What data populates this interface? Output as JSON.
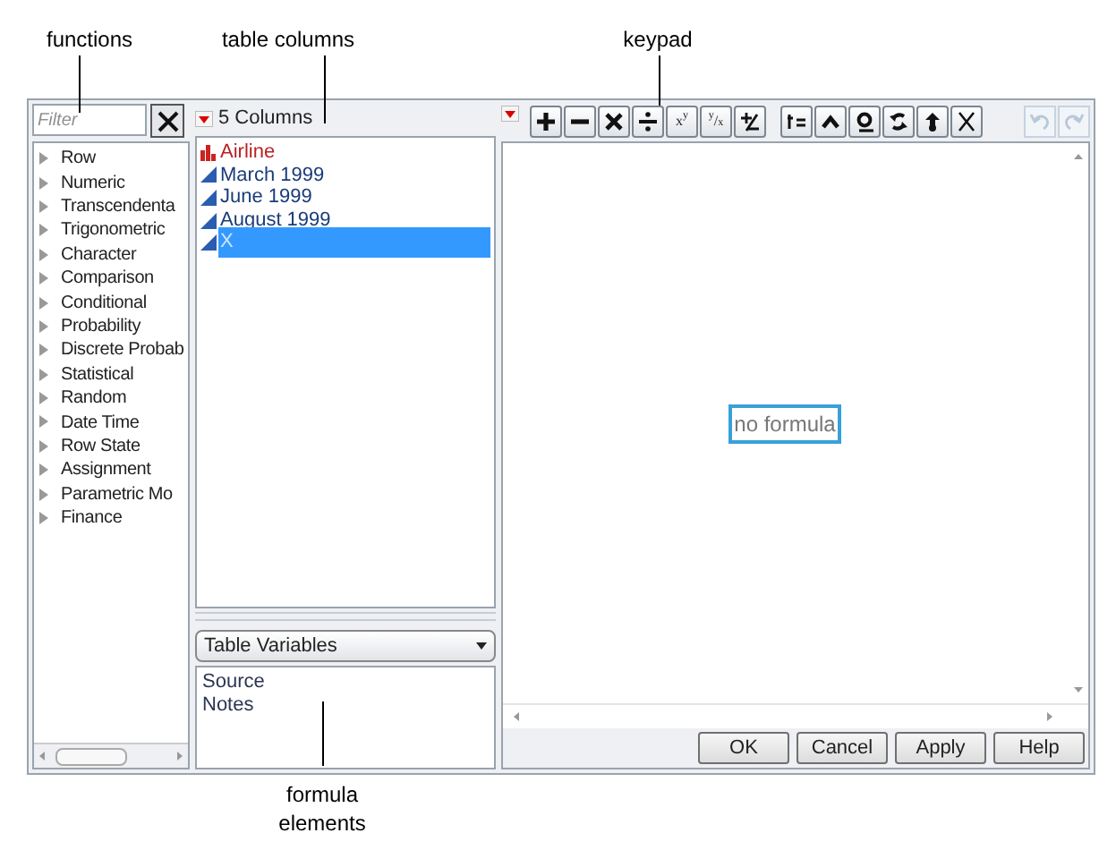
{
  "callouts": [
    {
      "text": "functions"
    },
    {
      "text": "table columns"
    },
    {
      "text": "keypad"
    },
    {
      "text": "formula elements"
    }
  ],
  "filter": {
    "placeholder": "Filter"
  },
  "functions": [
    {
      "label": "Row",
      "expanded": false
    },
    {
      "label": "Numeric",
      "expanded": false
    },
    {
      "label": "Transcendenta",
      "expanded": false
    },
    {
      "label": "Trigonometric",
      "expanded": false
    },
    {
      "label": "Character",
      "expanded": false
    },
    {
      "label": "Comparison",
      "expanded": false
    },
    {
      "label": "Conditional",
      "expanded": false
    },
    {
      "label": "Probability",
      "expanded": false
    },
    {
      "label": "Discrete Probab",
      "expanded": false
    },
    {
      "label": "Statistical",
      "expanded": false
    },
    {
      "label": "Random",
      "expanded": false
    },
    {
      "label": "Date Time",
      "expanded": false
    },
    {
      "label": "Row State",
      "expanded": false
    },
    {
      "label": "Assignment",
      "expanded": false
    },
    {
      "label": "Parametric Mo",
      "expanded": false
    },
    {
      "label": "Finance",
      "expanded": false
    }
  ],
  "columns_header": "5 Columns",
  "columns": [
    {
      "name": "Airline",
      "kind": "character",
      "selected": false
    },
    {
      "name": "March 1999",
      "kind": "numeric",
      "selected": false
    },
    {
      "name": "June 1999",
      "kind": "numeric",
      "selected": false
    },
    {
      "name": "August 1999",
      "kind": "numeric",
      "selected": false
    },
    {
      "name": "X",
      "kind": "numeric",
      "selected": true
    }
  ],
  "variables_dropdown": "Table Variables",
  "variables": [
    "Source",
    "Notes"
  ],
  "keypad": [
    [
      {
        "kind": "plus"
      },
      {
        "kind": "minus"
      },
      {
        "kind": "times"
      },
      {
        "kind": "divide"
      },
      {
        "kind": "text",
        "label": "x$^{y}$"
      },
      {
        "kind": "text",
        "label": "$^{y}$/$_{x}$"
      },
      {
        "kind": "plusminus"
      }
    ],
    [
      {
        "kind": "local"
      },
      {
        "kind": "caret"
      },
      {
        "kind": "peel"
      },
      {
        "kind": "swap"
      },
      {
        "kind": "unary"
      },
      {
        "kind": "delete"
      }
    ]
  ],
  "undo": {
    "disabled": true
  },
  "redo": {
    "disabled": true
  },
  "formula": {
    "text": "no formula"
  },
  "buttons": [
    "OK",
    "Cancel",
    "Apply",
    "Help"
  ]
}
